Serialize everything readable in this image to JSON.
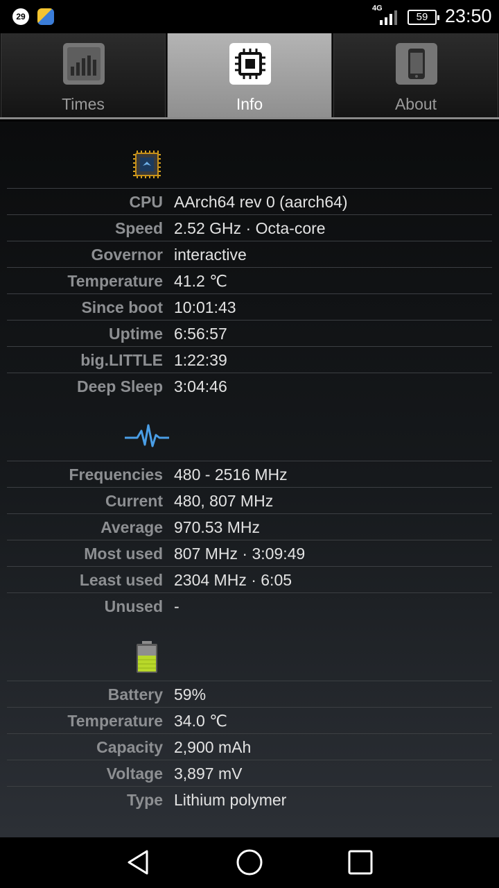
{
  "status_bar": {
    "calendar_day": "29",
    "network": "4G",
    "battery_level": "59",
    "time": "23:50"
  },
  "tabs": [
    {
      "label": "Times",
      "icon": "bar-chart-icon",
      "active": false
    },
    {
      "label": "Info",
      "icon": "cpu-chip-icon",
      "active": true
    },
    {
      "label": "About",
      "icon": "phone-icon",
      "active": false
    }
  ],
  "cpu": {
    "icon": "cpu-chip-icon",
    "rows": [
      {
        "label": "CPU",
        "value": "AArch64 rev 0 (aarch64)"
      },
      {
        "label": "Speed",
        "value": "2.52 GHz · Octa-core"
      },
      {
        "label": "Governor",
        "value": "interactive"
      },
      {
        "label": "Temperature",
        "value": "41.2 ℃"
      },
      {
        "label": "Since boot",
        "value": "10:01:43"
      },
      {
        "label": "Uptime",
        "value": "6:56:57"
      },
      {
        "label": "big.LITTLE",
        "value": "1:22:39"
      },
      {
        "label": "Deep Sleep",
        "value": "3:04:46"
      }
    ]
  },
  "frequency": {
    "icon": "pulse-wave-icon",
    "rows": [
      {
        "label": "Frequencies",
        "value": "480 - 2516 MHz"
      },
      {
        "label": "Current",
        "value": "480, 807 MHz"
      },
      {
        "label": "Average",
        "value": "970.53 MHz"
      },
      {
        "label": "Most used",
        "value": "807 MHz · 3:09:49"
      },
      {
        "label": "Least used",
        "value": "2304 MHz · 6:05"
      },
      {
        "label": "Unused",
        "value": "-"
      }
    ]
  },
  "battery": {
    "icon": "battery-icon",
    "rows": [
      {
        "label": "Battery",
        "value": "59%"
      },
      {
        "label": "Temperature",
        "value": "34.0 ℃"
      },
      {
        "label": "Capacity",
        "value": "2,900 mAh"
      },
      {
        "label": "Voltage",
        "value": "3,897 mV"
      },
      {
        "label": "Type",
        "value": "Lithium polymer"
      }
    ]
  },
  "nav": {
    "back": "back-triangle-icon",
    "home": "home-circle-icon",
    "recents": "recents-square-icon"
  }
}
